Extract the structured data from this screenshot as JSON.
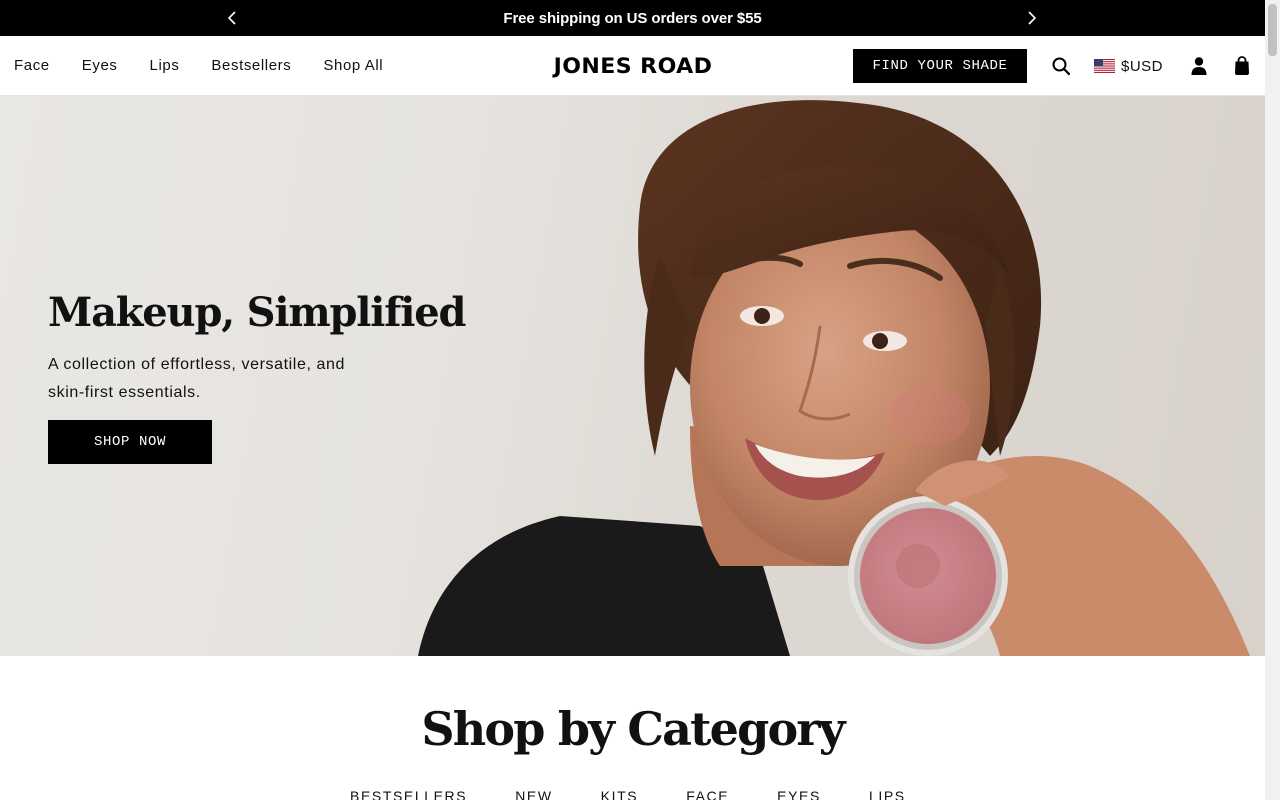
{
  "announcement": {
    "text": "Free shipping on US orders over $55"
  },
  "header": {
    "nav": [
      "Face",
      "Eyes",
      "Lips",
      "Bestsellers",
      "Shop All"
    ],
    "logo": "JONES ROAD",
    "find_shade_label": "FIND YOUR SHADE",
    "currency": "$USD"
  },
  "hero": {
    "title": "Makeup, Simplified",
    "subtitle": "A collection of effortless, versatile, and skin-first essentials.",
    "cta": "SHOP NOW"
  },
  "category_section": {
    "title": "Shop by Category",
    "tabs": [
      "BESTSELLERS",
      "NEW",
      "KITS",
      "FACE",
      "EYES",
      "LIPS"
    ]
  },
  "colors": {
    "primary": "#000000",
    "hero_bg": "#e7e4e0",
    "blush_pan": "#c97f86"
  },
  "icons": {
    "prev": "chevron-left-icon",
    "next": "chevron-right-icon",
    "search": "search-icon",
    "flag": "us-flag-icon",
    "account": "user-icon",
    "cart": "bag-icon"
  }
}
